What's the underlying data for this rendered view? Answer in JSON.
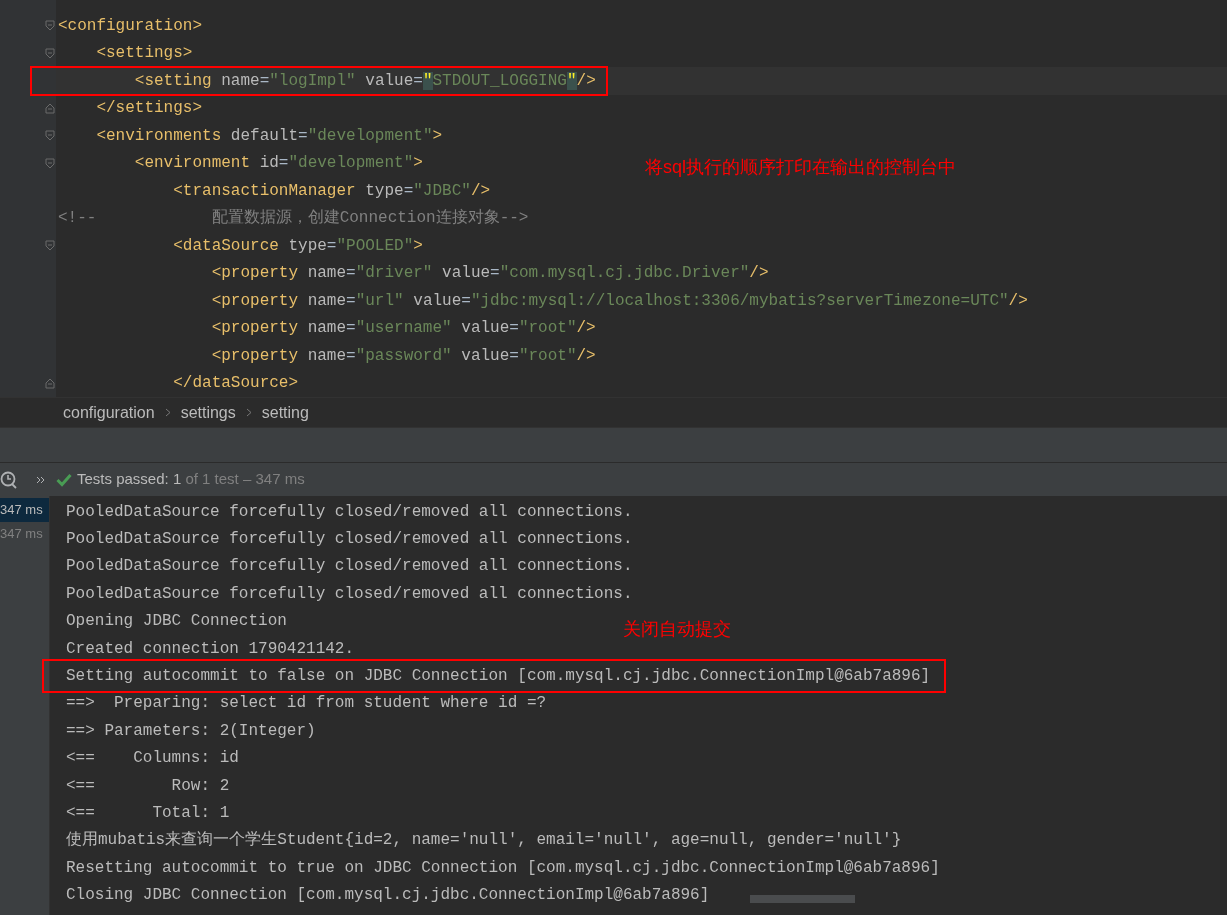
{
  "editor": {
    "lines": [
      {
        "kind": "fold_start",
        "tokens": [
          {
            "kind": "tag",
            "text": "<configuration>"
          }
        ]
      },
      {
        "kind": "fold_start",
        "tokens": [
          {
            "kind": "tag",
            "text": "    <settings>"
          }
        ]
      },
      {
        "kind": "plain",
        "current": true,
        "boxed": true,
        "tokens": [
          {
            "kind": "tag",
            "text": "        <setting "
          },
          {
            "kind": "attr",
            "text": "name"
          },
          {
            "kind": "eq",
            "text": "="
          },
          {
            "kind": "string",
            "text": "\"logImpl\""
          },
          {
            "kind": "attr",
            "text": " value"
          },
          {
            "kind": "eq",
            "text": "="
          },
          {
            "kind": "match",
            "text": "\""
          },
          {
            "kind": "string",
            "text": "STDOUT_LOGGING"
          },
          {
            "kind": "match",
            "text": "\""
          },
          {
            "kind": "tag",
            "text": "/>"
          }
        ]
      },
      {
        "kind": "fold_end",
        "tokens": [
          {
            "kind": "tag",
            "text": "    </settings>"
          }
        ]
      },
      {
        "kind": "fold_start",
        "tokens": [
          {
            "kind": "tag",
            "text": "    <environments "
          },
          {
            "kind": "attr",
            "text": "default"
          },
          {
            "kind": "eq",
            "text": "="
          },
          {
            "kind": "string",
            "text": "\"development\""
          },
          {
            "kind": "tag",
            "text": ">"
          }
        ]
      },
      {
        "kind": "fold_start",
        "tokens": [
          {
            "kind": "tag",
            "text": "        <environment "
          },
          {
            "kind": "attr",
            "text": "id"
          },
          {
            "kind": "eq",
            "text": "="
          },
          {
            "kind": "string",
            "text": "\"development\""
          },
          {
            "kind": "tag",
            "text": ">"
          }
        ]
      },
      {
        "kind": "plain",
        "tokens": [
          {
            "kind": "tag",
            "text": "            <transactionManager "
          },
          {
            "kind": "attr",
            "text": "type"
          },
          {
            "kind": "eq",
            "text": "="
          },
          {
            "kind": "string",
            "text": "\"JDBC\""
          },
          {
            "kind": "tag",
            "text": "/>"
          }
        ]
      },
      {
        "kind": "plain",
        "tokens": [
          {
            "kind": "comment",
            "text": "<!--            配置数据源，创建Connection连接对象-->"
          }
        ]
      },
      {
        "kind": "fold_start",
        "tokens": [
          {
            "kind": "tag",
            "text": "            <dataSource "
          },
          {
            "kind": "attr",
            "text": "type"
          },
          {
            "kind": "eq",
            "text": "="
          },
          {
            "kind": "string",
            "text": "\"POOLED\""
          },
          {
            "kind": "tag",
            "text": ">"
          }
        ]
      },
      {
        "kind": "plain",
        "tokens": [
          {
            "kind": "tag",
            "text": "                <property "
          },
          {
            "kind": "attr",
            "text": "name"
          },
          {
            "kind": "eq",
            "text": "="
          },
          {
            "kind": "string",
            "text": "\"driver\""
          },
          {
            "kind": "attr",
            "text": " value"
          },
          {
            "kind": "eq",
            "text": "="
          },
          {
            "kind": "string",
            "text": "\"com.mysql.cj.jdbc.Driver\""
          },
          {
            "kind": "tag",
            "text": "/>"
          }
        ]
      },
      {
        "kind": "plain",
        "tokens": [
          {
            "kind": "tag",
            "text": "                <property "
          },
          {
            "kind": "attr",
            "text": "name"
          },
          {
            "kind": "eq",
            "text": "="
          },
          {
            "kind": "string",
            "text": "\"url\""
          },
          {
            "kind": "attr",
            "text": " value"
          },
          {
            "kind": "eq",
            "text": "="
          },
          {
            "kind": "string",
            "text": "\"jdbc:mysql://localhost:3306/mybatis?serverTimezone=UTC\""
          },
          {
            "kind": "tag",
            "text": "/>"
          }
        ]
      },
      {
        "kind": "plain",
        "tokens": [
          {
            "kind": "tag",
            "text": "                <property "
          },
          {
            "kind": "attr",
            "text": "name"
          },
          {
            "kind": "eq",
            "text": "="
          },
          {
            "kind": "string",
            "text": "\"username\""
          },
          {
            "kind": "attr",
            "text": " value"
          },
          {
            "kind": "eq",
            "text": "="
          },
          {
            "kind": "string",
            "text": "\"root\""
          },
          {
            "kind": "tag",
            "text": "/>"
          }
        ]
      },
      {
        "kind": "plain",
        "tokens": [
          {
            "kind": "tag",
            "text": "                <property "
          },
          {
            "kind": "attr",
            "text": "name"
          },
          {
            "kind": "eq",
            "text": "="
          },
          {
            "kind": "string",
            "text": "\"password\""
          },
          {
            "kind": "attr",
            "text": " value"
          },
          {
            "kind": "eq",
            "text": "="
          },
          {
            "kind": "string",
            "text": "\"root\""
          },
          {
            "kind": "tag",
            "text": "/>"
          }
        ]
      },
      {
        "kind": "fold_end",
        "tokens": [
          {
            "kind": "tag",
            "text": "            </dataSource>"
          }
        ]
      }
    ],
    "annotation": "将sql执行的顺序打印在输出的控制台中"
  },
  "breadcrumbs": [
    "configuration",
    "settings",
    "setting"
  ],
  "test_bar": {
    "label": "Tests passed: ",
    "count": "1",
    "detail": " of 1 test – 347 ms"
  },
  "test_times": [
    {
      "text": "347 ms",
      "selected": true
    },
    {
      "text": "347 ms",
      "selected": false
    }
  ],
  "console": {
    "lines": [
      {
        "text": "PooledDataSource forcefully closed/removed all connections."
      },
      {
        "text": "PooledDataSource forcefully closed/removed all connections."
      },
      {
        "text": "PooledDataSource forcefully closed/removed all connections."
      },
      {
        "text": "PooledDataSource forcefully closed/removed all connections."
      },
      {
        "text": "Opening JDBC Connection"
      },
      {
        "text": "Created connection 1790421142."
      },
      {
        "text": "Setting autocommit to false on JDBC Connection [com.mysql.cj.jdbc.ConnectionImpl@6ab7a896]",
        "boxed": true
      },
      {
        "text": "==>  Preparing: select id from student where id =?"
      },
      {
        "text": "==> Parameters: 2(Integer)"
      },
      {
        "text": "<==    Columns: id"
      },
      {
        "text": "<==        Row: 2"
      },
      {
        "text": "<==      Total: 1"
      },
      {
        "text": "使用mubatis来查询一个学生Student{id=2, name='null', email='null', age=null, gender='null'}"
      },
      {
        "text": "Resetting autocommit to true on JDBC Connection [com.mysql.cj.jdbc.ConnectionImpl@6ab7a896]"
      },
      {
        "text": "Closing JDBC Connection [com.mysql.cj.jdbc.ConnectionImpl@6ab7a896]"
      }
    ],
    "annotation": "关闭自动提交"
  }
}
